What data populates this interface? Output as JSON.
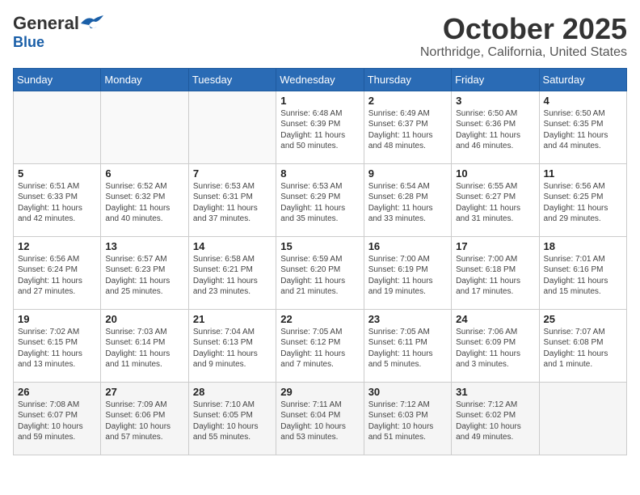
{
  "logo": {
    "general": "General",
    "blue": "Blue"
  },
  "title": {
    "month_year": "October 2025",
    "location": "Northridge, California, United States"
  },
  "weekdays": [
    "Sunday",
    "Monday",
    "Tuesday",
    "Wednesday",
    "Thursday",
    "Friday",
    "Saturday"
  ],
  "weeks": [
    [
      {
        "day": "",
        "info": ""
      },
      {
        "day": "",
        "info": ""
      },
      {
        "day": "",
        "info": ""
      },
      {
        "day": "1",
        "info": "Sunrise: 6:48 AM\nSunset: 6:39 PM\nDaylight: 11 hours\nand 50 minutes."
      },
      {
        "day": "2",
        "info": "Sunrise: 6:49 AM\nSunset: 6:37 PM\nDaylight: 11 hours\nand 48 minutes."
      },
      {
        "day": "3",
        "info": "Sunrise: 6:50 AM\nSunset: 6:36 PM\nDaylight: 11 hours\nand 46 minutes."
      },
      {
        "day": "4",
        "info": "Sunrise: 6:50 AM\nSunset: 6:35 PM\nDaylight: 11 hours\nand 44 minutes."
      }
    ],
    [
      {
        "day": "5",
        "info": "Sunrise: 6:51 AM\nSunset: 6:33 PM\nDaylight: 11 hours\nand 42 minutes."
      },
      {
        "day": "6",
        "info": "Sunrise: 6:52 AM\nSunset: 6:32 PM\nDaylight: 11 hours\nand 40 minutes."
      },
      {
        "day": "7",
        "info": "Sunrise: 6:53 AM\nSunset: 6:31 PM\nDaylight: 11 hours\nand 37 minutes."
      },
      {
        "day": "8",
        "info": "Sunrise: 6:53 AM\nSunset: 6:29 PM\nDaylight: 11 hours\nand 35 minutes."
      },
      {
        "day": "9",
        "info": "Sunrise: 6:54 AM\nSunset: 6:28 PM\nDaylight: 11 hours\nand 33 minutes."
      },
      {
        "day": "10",
        "info": "Sunrise: 6:55 AM\nSunset: 6:27 PM\nDaylight: 11 hours\nand 31 minutes."
      },
      {
        "day": "11",
        "info": "Sunrise: 6:56 AM\nSunset: 6:25 PM\nDaylight: 11 hours\nand 29 minutes."
      }
    ],
    [
      {
        "day": "12",
        "info": "Sunrise: 6:56 AM\nSunset: 6:24 PM\nDaylight: 11 hours\nand 27 minutes."
      },
      {
        "day": "13",
        "info": "Sunrise: 6:57 AM\nSunset: 6:23 PM\nDaylight: 11 hours\nand 25 minutes."
      },
      {
        "day": "14",
        "info": "Sunrise: 6:58 AM\nSunset: 6:21 PM\nDaylight: 11 hours\nand 23 minutes."
      },
      {
        "day": "15",
        "info": "Sunrise: 6:59 AM\nSunset: 6:20 PM\nDaylight: 11 hours\nand 21 minutes."
      },
      {
        "day": "16",
        "info": "Sunrise: 7:00 AM\nSunset: 6:19 PM\nDaylight: 11 hours\nand 19 minutes."
      },
      {
        "day": "17",
        "info": "Sunrise: 7:00 AM\nSunset: 6:18 PM\nDaylight: 11 hours\nand 17 minutes."
      },
      {
        "day": "18",
        "info": "Sunrise: 7:01 AM\nSunset: 6:16 PM\nDaylight: 11 hours\nand 15 minutes."
      }
    ],
    [
      {
        "day": "19",
        "info": "Sunrise: 7:02 AM\nSunset: 6:15 PM\nDaylight: 11 hours\nand 13 minutes."
      },
      {
        "day": "20",
        "info": "Sunrise: 7:03 AM\nSunset: 6:14 PM\nDaylight: 11 hours\nand 11 minutes."
      },
      {
        "day": "21",
        "info": "Sunrise: 7:04 AM\nSunset: 6:13 PM\nDaylight: 11 hours\nand 9 minutes."
      },
      {
        "day": "22",
        "info": "Sunrise: 7:05 AM\nSunset: 6:12 PM\nDaylight: 11 hours\nand 7 minutes."
      },
      {
        "day": "23",
        "info": "Sunrise: 7:05 AM\nSunset: 6:11 PM\nDaylight: 11 hours\nand 5 minutes."
      },
      {
        "day": "24",
        "info": "Sunrise: 7:06 AM\nSunset: 6:09 PM\nDaylight: 11 hours\nand 3 minutes."
      },
      {
        "day": "25",
        "info": "Sunrise: 7:07 AM\nSunset: 6:08 PM\nDaylight: 11 hours\nand 1 minute."
      }
    ],
    [
      {
        "day": "26",
        "info": "Sunrise: 7:08 AM\nSunset: 6:07 PM\nDaylight: 10 hours\nand 59 minutes."
      },
      {
        "day": "27",
        "info": "Sunrise: 7:09 AM\nSunset: 6:06 PM\nDaylight: 10 hours\nand 57 minutes."
      },
      {
        "day": "28",
        "info": "Sunrise: 7:10 AM\nSunset: 6:05 PM\nDaylight: 10 hours\nand 55 minutes."
      },
      {
        "day": "29",
        "info": "Sunrise: 7:11 AM\nSunset: 6:04 PM\nDaylight: 10 hours\nand 53 minutes."
      },
      {
        "day": "30",
        "info": "Sunrise: 7:12 AM\nSunset: 6:03 PM\nDaylight: 10 hours\nand 51 minutes."
      },
      {
        "day": "31",
        "info": "Sunrise: 7:12 AM\nSunset: 6:02 PM\nDaylight: 10 hours\nand 49 minutes."
      },
      {
        "day": "",
        "info": ""
      }
    ]
  ]
}
